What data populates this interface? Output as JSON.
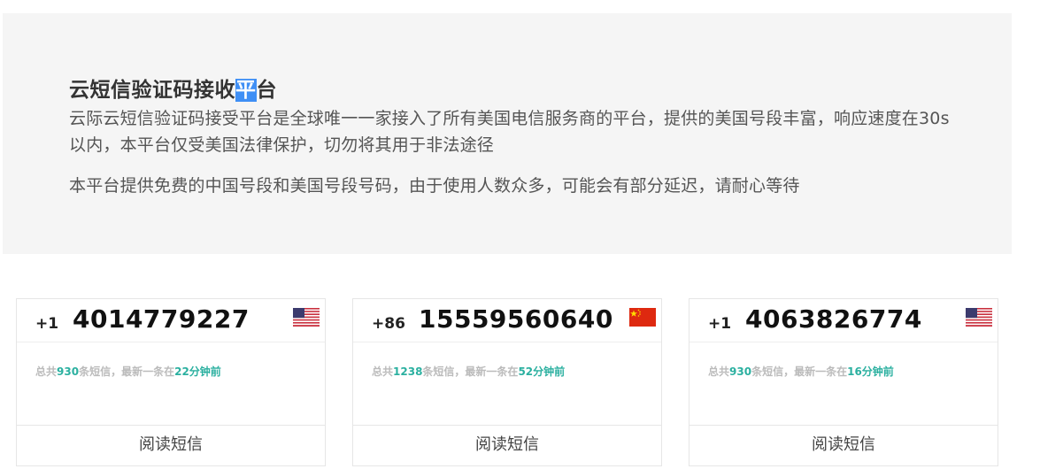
{
  "hero": {
    "title_prefix": "云短信验证码接收",
    "title_selected": "平",
    "title_suffix": "台",
    "paragraph1": "云际云短信验证码接受平台是全球唯一一家接入了所有美国电信服务商的平台，提供的美国号段丰富，响应速度在30s以内，本平台仅受美国法律保护，切勿将其用于非法途径",
    "paragraph2": "本平台提供免费的中国号段和美国号段号码，由于使用人数众多，可能会有部分延迟，请耐心等待"
  },
  "cards": [
    {
      "country_code": "+1",
      "number": "4014779227",
      "flag": "us-flag-icon",
      "stat_prefix": "总共",
      "count": "930",
      "stat_mid": "条短信，最新一条在",
      "age": "22分钟前",
      "read_label": "阅读短信"
    },
    {
      "country_code": "+86",
      "number": "15559560640",
      "flag": "cn-flag-icon",
      "stat_prefix": "总共",
      "count": "1238",
      "stat_mid": "条短信，最新一条在",
      "age": "52分钟前",
      "read_label": "阅读短信"
    },
    {
      "country_code": "+1",
      "number": "4063826774",
      "flag": "us-flag-icon",
      "stat_prefix": "总共",
      "count": "930",
      "stat_mid": "条短信，最新一条在",
      "age": "16分钟前",
      "read_label": "阅读短信"
    }
  ],
  "colors": {
    "accent": "#2bb0a0",
    "hero_bg": "#f5f5f5",
    "selection": "#3f8ff5"
  }
}
